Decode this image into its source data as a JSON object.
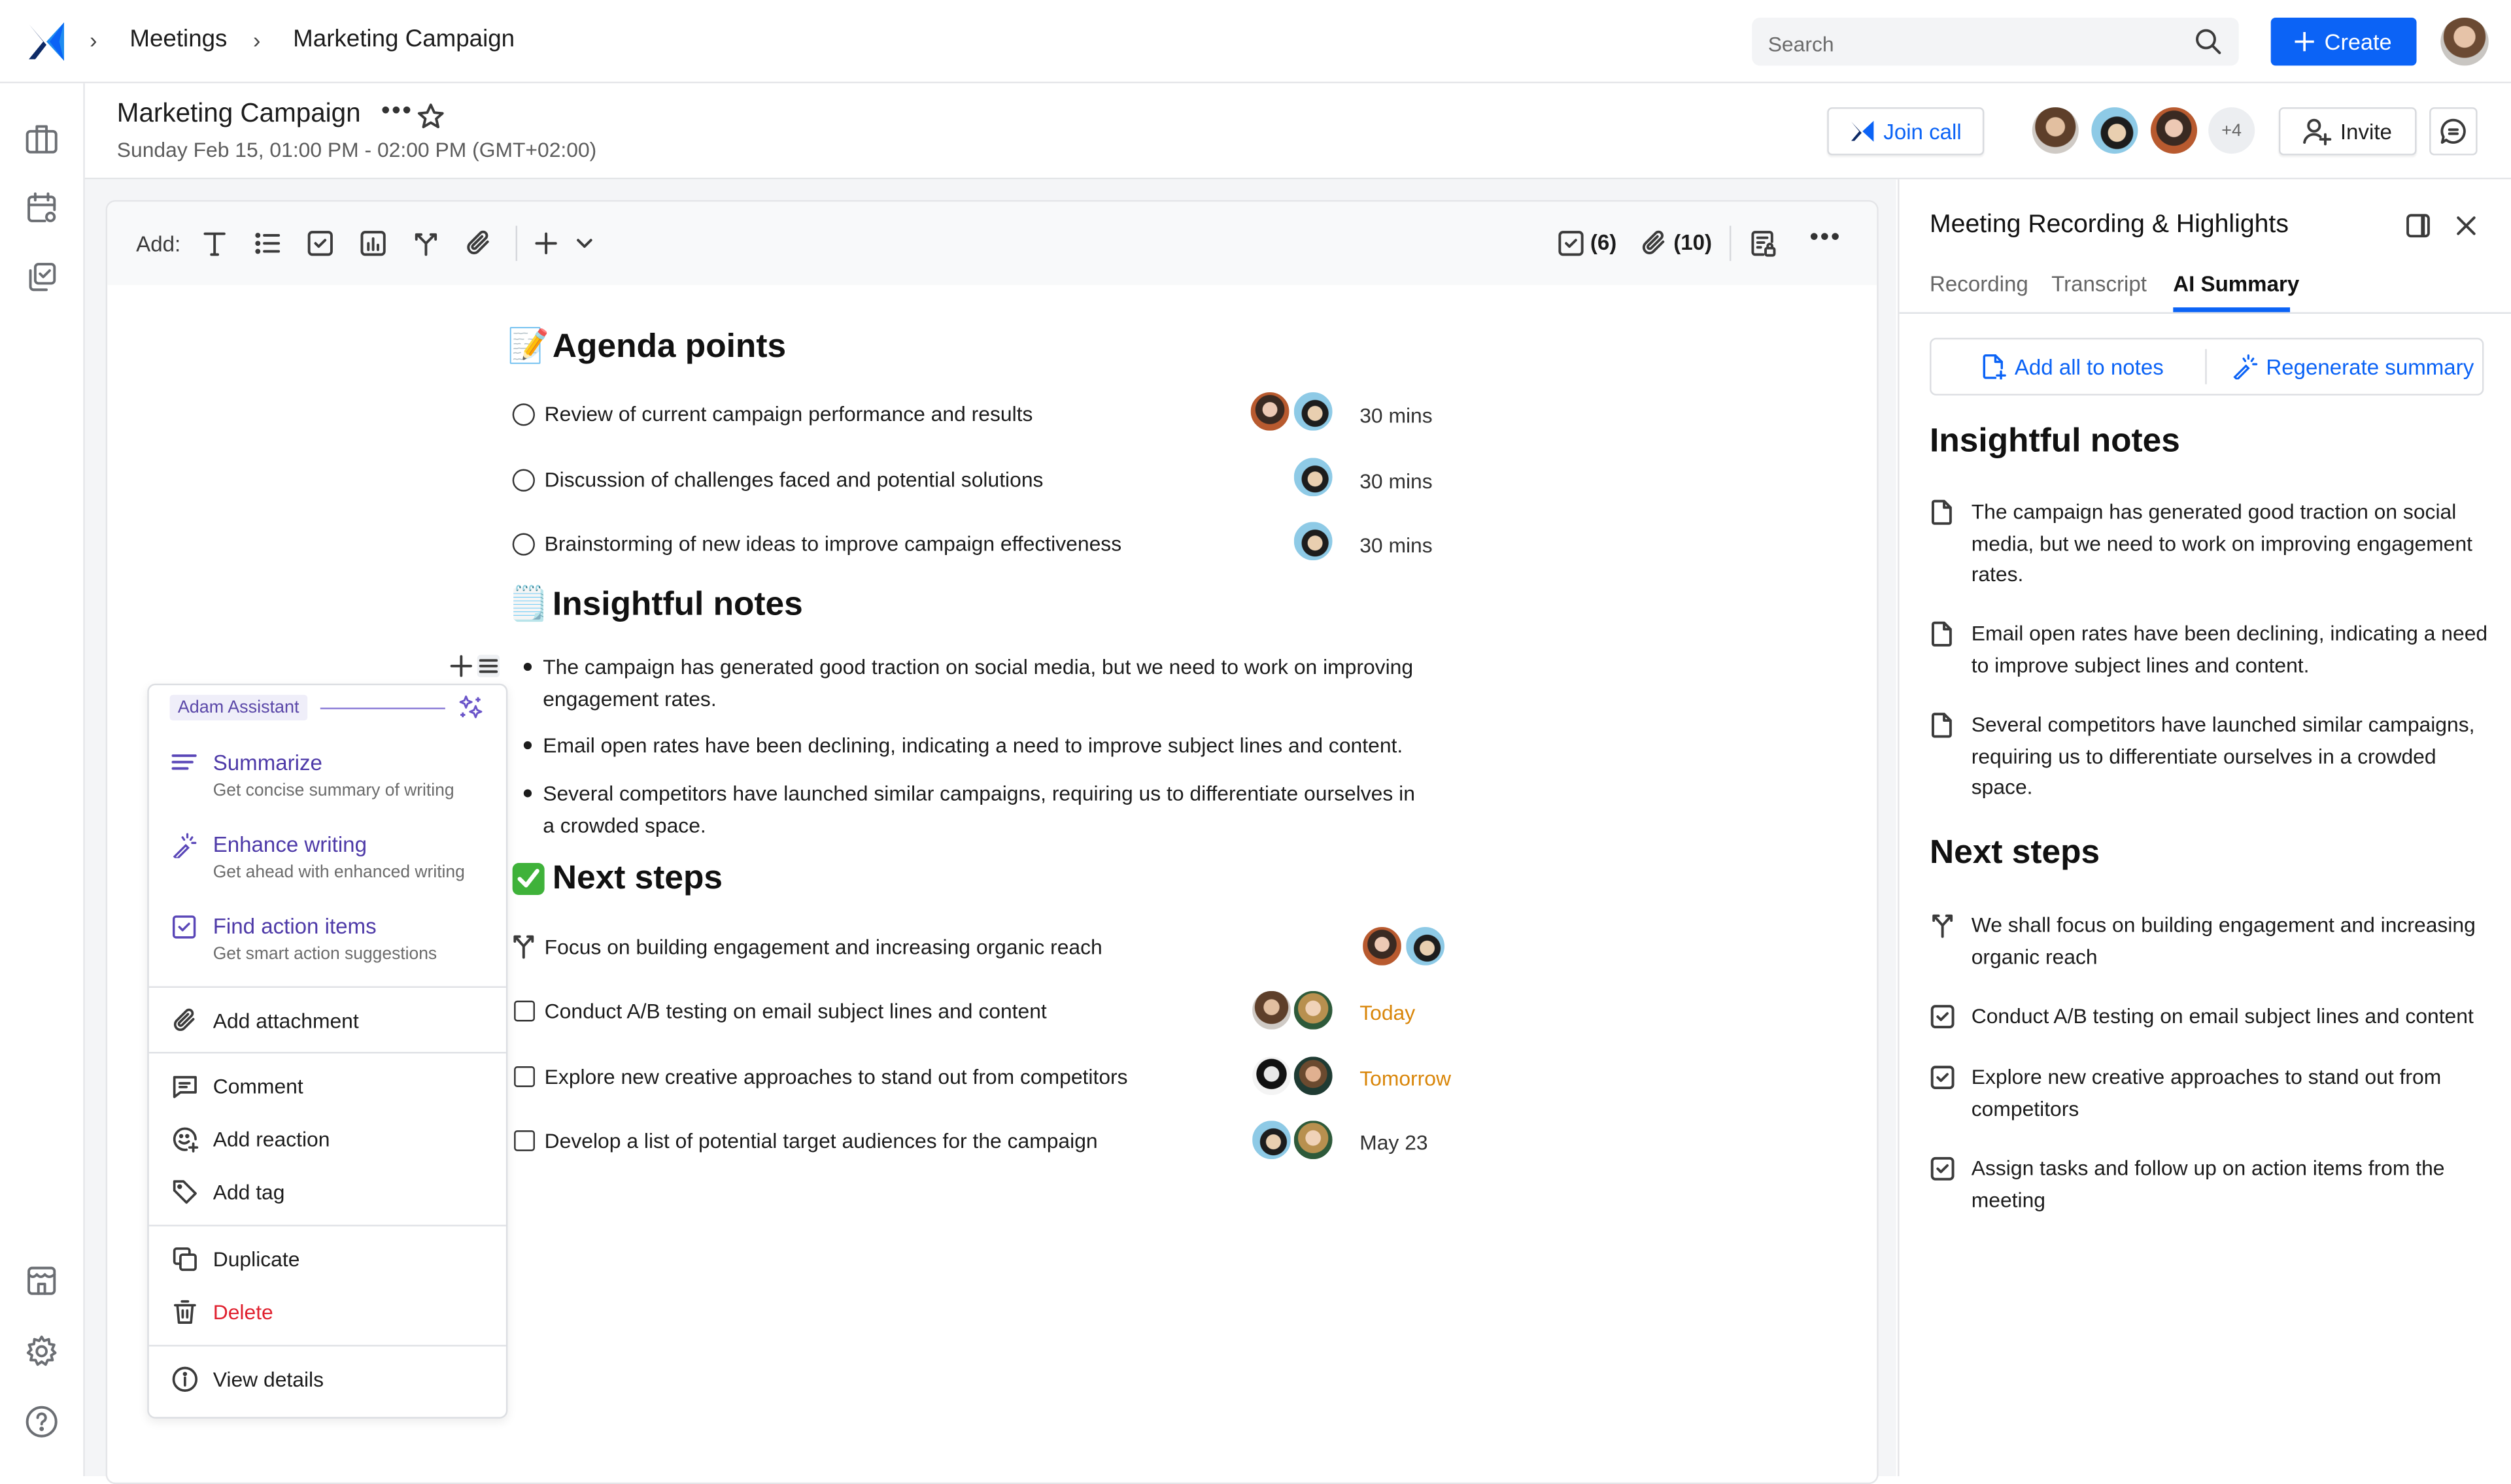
{
  "topbar": {
    "breadcrumbs": [
      "Meetings",
      "Marketing Campaign"
    ],
    "search_placeholder": "Search",
    "create_label": "Create"
  },
  "meeting": {
    "title": "Marketing Campaign",
    "date": "Sunday Feb 15, 01:00 PM - 02:00 PM (GMT+02:00)",
    "join_call_label": "Join call",
    "extra_participants": "+4",
    "invite_label": "Invite"
  },
  "toolbar": {
    "add_label": "Add:",
    "tasks_count": "(6)",
    "attachments_count": "(10)"
  },
  "editor": {
    "agenda": {
      "heading": "Agenda points",
      "emoji": "📝",
      "items": [
        {
          "text": "Review of current campaign performance and results",
          "duration": "30 mins"
        },
        {
          "text": "Discussion of challenges faced and potential solutions",
          "duration": "30 mins"
        },
        {
          "text": "Brainstorming of new ideas to improve campaign effectiveness",
          "duration": "30 mins"
        }
      ]
    },
    "notes": {
      "heading": "Insightful notes",
      "emoji": "🗒️",
      "items": [
        "The campaign has generated good traction on social media, but we need to work on improving engagement rates.",
        "Email open rates have been declining, indicating a need to improve subject lines and content.",
        "Several competitors have launched similar campaigns, requiring us to differentiate ourselves in a crowded space."
      ]
    },
    "next_steps": {
      "heading": "Next steps",
      "emoji": "✅",
      "items": [
        {
          "text": "Focus on building engagement and increasing organic reach",
          "type": "decision",
          "due": ""
        },
        {
          "text": "Conduct A/B testing on email subject lines and content",
          "type": "task",
          "due": "Today",
          "due_color": "#d9860a"
        },
        {
          "text": "Explore new creative approaches to stand out from competitors",
          "type": "task",
          "due": "Tomorrow",
          "due_color": "#d9860a"
        },
        {
          "text": "Develop a list of potential target audiences for the campaign",
          "type": "task",
          "due": "May 23",
          "due_color": "#333333"
        }
      ]
    }
  },
  "context_menu": {
    "assistant_label": "Adam Assistant",
    "ai_items": [
      {
        "title": "Summarize",
        "subtitle": "Get concise summary of writing",
        "icon": "summarize-icon"
      },
      {
        "title": "Enhance writing",
        "subtitle": "Get ahead with enhanced writing",
        "icon": "magic-wand-icon"
      },
      {
        "title": "Find action items",
        "subtitle": "Get smart action suggestions",
        "icon": "checkbox-icon"
      }
    ],
    "items": [
      {
        "label": "Add attachment",
        "icon": "paperclip-icon"
      },
      {
        "label": "Comment",
        "icon": "comment-icon"
      },
      {
        "label": "Add reaction",
        "icon": "emoji-add-icon"
      },
      {
        "label": "Add tag",
        "icon": "tag-icon"
      },
      {
        "label": "Duplicate",
        "icon": "duplicate-icon"
      },
      {
        "label": "Delete",
        "icon": "trash-icon"
      },
      {
        "label": "View details",
        "icon": "info-icon"
      }
    ]
  },
  "right_panel": {
    "title": "Meeting Recording & Highlights",
    "tabs": [
      {
        "label": "Recording",
        "active": false
      },
      {
        "label": "Transcript",
        "active": false
      },
      {
        "label": "AI Summary",
        "active": true
      }
    ],
    "actions": {
      "add_all": "Add all to notes",
      "regenerate": "Regenerate summary"
    },
    "notes_heading": "Insightful notes",
    "notes": [
      "The campaign has generated good traction on social media, but we need to work on improving engagement rates.",
      "Email open rates have been declining, indicating a need to improve subject lines and content.",
      "Several competitors have launched similar campaigns, requiring us to differentiate ourselves in a crowded space."
    ],
    "next_steps_heading": "Next steps",
    "next_steps": [
      {
        "text": "We shall focus on building engagement and increasing organic reach",
        "type": "decision"
      },
      {
        "text": "Conduct A/B testing on email subject lines and content",
        "type": "task"
      },
      {
        "text": "Explore new creative approaches to stand out from competitors",
        "type": "task"
      },
      {
        "text": "Assign tasks and follow up on action items from the meeting",
        "type": "task"
      }
    ]
  },
  "colors": {
    "primary": "#0b63f6",
    "assistant_purple": "#4e3aa8",
    "danger": "#e0202e",
    "due_warning": "#d9860a"
  }
}
